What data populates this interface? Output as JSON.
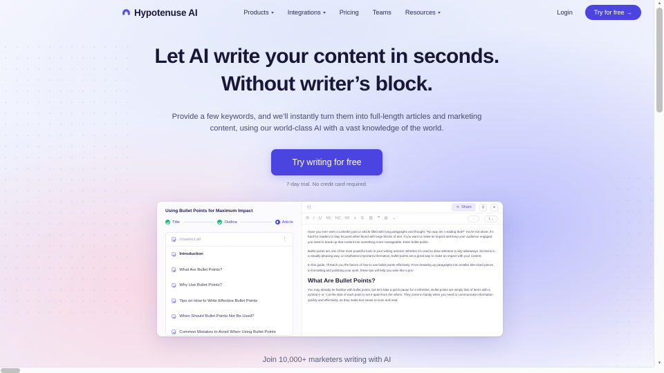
{
  "brand": {
    "name": "Hypotenuse AI",
    "logo_icon": "hypotenuse-logo-icon",
    "accent_color": "#4b44e0"
  },
  "nav": {
    "items": [
      {
        "label": "Products",
        "has_caret": true
      },
      {
        "label": "Integrations",
        "has_caret": true
      },
      {
        "label": "Pricing",
        "has_caret": false
      },
      {
        "label": "Teams",
        "has_caret": false
      },
      {
        "label": "Resources",
        "has_caret": true
      }
    ],
    "login_label": "Login",
    "cta_label": "Try for free →"
  },
  "hero": {
    "headline_line1": "Let AI write your content in seconds.",
    "headline_line2": "Without writer’s block.",
    "subheadline": "Provide a few keywords, and we’ll instantly turn them into full-length articles and marketing content, using our world-class AI with a vast knowledge of the world.",
    "cta_label": "Try writing for free",
    "cta_note": "7-day trial. No credit card required."
  },
  "app": {
    "doc_title": "Using Bullet Points for Maximum Impact",
    "steps": [
      {
        "label": "Title",
        "state": "done"
      },
      {
        "label": "Outline",
        "state": "done"
      },
      {
        "label": "Article",
        "state": "active"
      }
    ],
    "outline": {
      "unselect_label": "Unselect all",
      "menu_icon": "kebab-menu-icon",
      "items": [
        {
          "label": "Introduction",
          "strong": true
        },
        {
          "label": "What Are Bullet Points?",
          "strong": false
        },
        {
          "label": "Why Use Bullet Points?",
          "strong": false
        },
        {
          "label": "Tips on How to Write Effective Bullet Points",
          "strong": false
        },
        {
          "label": "When Should Bullet Points Not Be Used?",
          "strong": false
        },
        {
          "label": "Common Mistakes to Avoid When Using Bullet Points",
          "strong": false
        }
      ]
    },
    "editor": {
      "add_block_icon": "add-block-icon",
      "share_label": "Share",
      "share_icon": "share-icon",
      "plagiarism_icon": "plagiarism-check-icon",
      "settings_icon": "sparkle-icon",
      "tools": [
        "B",
        "I",
        "U",
        "H1",
        "H2",
        "H3",
        "≡",
        "☰",
        "🔗",
        "❝",
        "▦",
        "⌄"
      ],
      "undo_icon": "history-icon",
      "export_icon": "download-icon",
      "paragraph1": "Have you ever seen a LinkedIn post or article filled with long paragraphs and thought, \"No way am I reading that?\" You're not alone. It's hard for readers to stay focused when faced with large blocks of text. If you want to make an impact and keep your audience engaged, you need to break up that content into something more manageable. Enter bullet points.",
      "paragraph2": "Bullet points are one of the most powerful tools in your writing arsenal. Whether it's used to draw attention to key takeaways, list items in a visually pleasing way, or emphasise important information, bullet points are a great way to make an impact with your content.",
      "paragraph3": "In this guide, I'll teach you the basics of how to use bullet points effectively. From breaking up paragraphs into smaller bite-sized pieces to formatting and polishing your work, these tips will help you write like a pro!",
      "heading": "What Are Bullet Points?",
      "paragraph4": "You may already be familiar with bullet points, but let's take a quick pause for a refresher. Bullet points are simply lists of items with a symbol (• or -) at the start of each point to set it apart from the others. They come in handy when you need to communicate information quickly and effectively, as they make text easier to scan and read."
    }
  },
  "footer_strip": {
    "text": "Join 10,000+ marketers writing with AI"
  },
  "browser": {
    "scroll_up_icon": "caret-up-icon",
    "scroll_down_icon": "caret-down-icon"
  }
}
